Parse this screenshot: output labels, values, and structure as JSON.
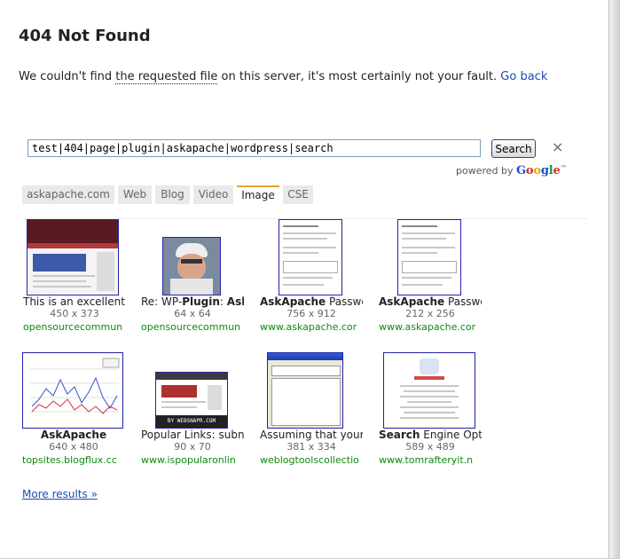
{
  "page": {
    "title": "404 Not Found",
    "message_before": "We couldn't find ",
    "message_link": "the requested file",
    "message_after": " on this server, it's most certainly not your fault.",
    "go_back": "Go back"
  },
  "search": {
    "query": "test|404|page|plugin|askapache|wordpress|search",
    "button": "Search",
    "close": "×",
    "powered_by": "powered by",
    "brand": "Google",
    "tm": "™"
  },
  "tabs": [
    {
      "label": "askapache.com",
      "active": false
    },
    {
      "label": "Web",
      "active": false
    },
    {
      "label": "Blog",
      "active": false
    },
    {
      "label": "Video",
      "active": false
    },
    {
      "label": "Image",
      "active": true
    },
    {
      "label": "CSE",
      "active": false
    }
  ],
  "results": [
    {
      "title_html": "This is an excellent",
      "dims": "450 x 373",
      "url": "opensourcecommun"
    },
    {
      "title_html": "Re: WP-<b>Plugin</b>: <b>Ask</b>",
      "dims": "64 x 64",
      "url": "opensourcecommun"
    },
    {
      "title_html": "<b>AskApache</b> Passwo",
      "dims": "756 x 912",
      "url": "www.askapache.cor"
    },
    {
      "title_html": "<b>AskApache</b> Passwo",
      "dims": "212 x 256",
      "url": "www.askapache.cor"
    },
    {
      "title_html": "<b>AskApache</b>",
      "dims": "640 x 480",
      "url": "topsites.blogflux.cc"
    },
    {
      "title_html": "Popular Links: subn",
      "dims": "90 x 70",
      "url": "www.ispopularonlin"
    },
    {
      "title_html": "Assuming that your",
      "dims": "381 x 334",
      "url": "weblogtoolscollectio"
    },
    {
      "title_html": "<b>Search</b> Engine Opti",
      "dims": "589 x 489",
      "url": "www.tomrafteryit.n"
    }
  ],
  "more_results": "More results »",
  "thumb_text": {
    "websnapr": "BY WEBSNAPR.COM"
  },
  "colors": {
    "link": "#1a4cb4",
    "url_green": "#0e8a0e",
    "active_tab_accent": "#e8a32e",
    "thumb_border": "#2222aa"
  }
}
